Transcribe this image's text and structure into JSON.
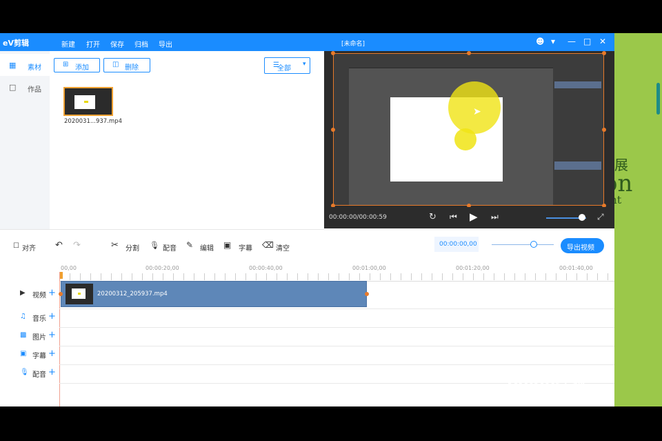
{
  "app": {
    "logo": "eV剪辑",
    "menu": [
      "新建",
      "打开",
      "保存",
      "归档",
      "导出"
    ],
    "title": "[未命名]",
    "window_icons": [
      "user-icon",
      "dropdown-icon",
      "minimize-icon",
      "maximize-icon",
      "close-icon"
    ]
  },
  "sidebar": {
    "items": [
      {
        "label": "素材",
        "icon": "grid-icon",
        "active": true
      },
      {
        "label": "作品",
        "icon": "folder-icon",
        "active": false
      }
    ]
  },
  "media": {
    "add_label": "添加",
    "delete_label": "删除",
    "filter_label": "全部",
    "file_name": "2020031...937.mp4"
  },
  "preview": {
    "time": "00:00:00/00:00:59",
    "volume_fraction": 0.9
  },
  "toolbar": {
    "align": "对齐",
    "split": "分割",
    "dub": "配音",
    "edit": "编辑",
    "subtitle": "字幕",
    "clear": "清空",
    "current_time": "00:00:00,00",
    "zoom_fraction": 0.68,
    "export": "导出视频"
  },
  "timeline": {
    "ticks": [
      "00,00",
      "00:00:20,00",
      "00:00:40,00",
      "00:01:00,00",
      "00:01:20,00",
      "00:01:40,00"
    ],
    "tracks": [
      {
        "label": "视频",
        "icon": "video-icon"
      },
      {
        "label": "音乐",
        "icon": "music-icon"
      },
      {
        "label": "图片",
        "icon": "image-icon"
      },
      {
        "label": "字幕",
        "icon": "text-icon"
      },
      {
        "label": "配音",
        "icon": "mic-icon"
      }
    ],
    "clip_name": "20200312_205937.mp4"
  },
  "watermark": {
    "brand": "Baidu经验",
    "url": "jingyan.baidu.com"
  },
  "background_text": [
    "展",
    "on",
    "ent"
  ],
  "colors": {
    "accent": "#1a8cff",
    "clip": "#5e87b8",
    "selection": "#e87a2a",
    "backdrop": "#9bc84a"
  }
}
